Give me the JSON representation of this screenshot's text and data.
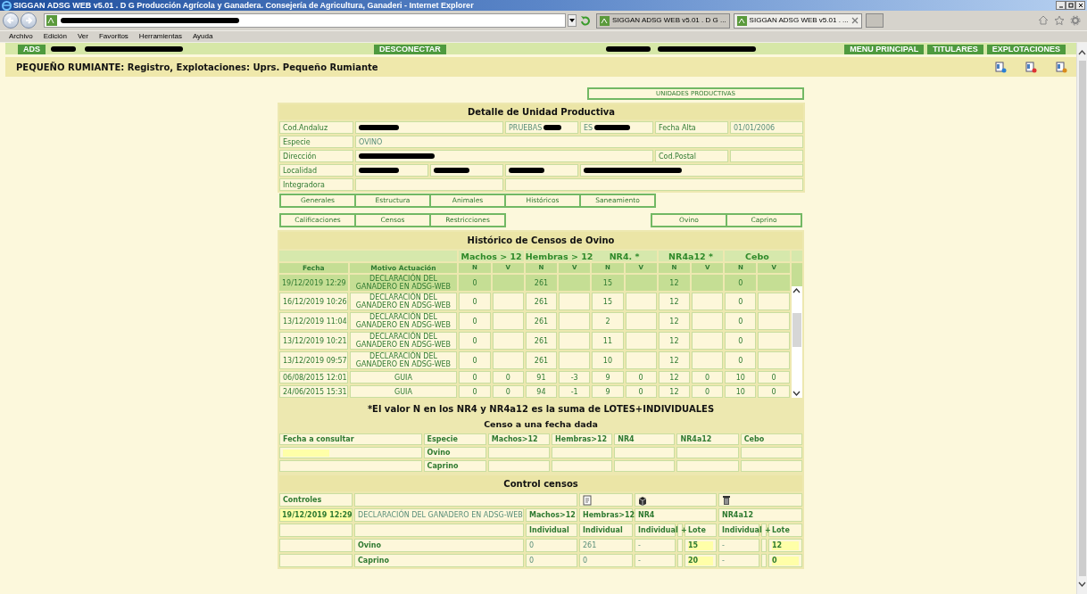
{
  "browser": {
    "title": "SIGGAN ADSG WEB v5.01 . D G Producción Agrícola y Ganadera. Consejería de Agricultura, Ganaderi - Internet Explorer",
    "address": {
      "redacted": true
    },
    "tabs": [
      {
        "label": "SIGGAN ADSG WEB v5.01 . D G ...",
        "selected": false
      },
      {
        "label": "SIGGAN ADSG WEB v5.01 . ...",
        "selected": true
      }
    ],
    "menu": [
      "Archivo",
      "Edición",
      "Ver",
      "Favoritos",
      "Herramientas",
      "Ayuda"
    ]
  },
  "nav": [
    {
      "label": "ADS"
    },
    {
      "redacted": true
    },
    {
      "redacted": true
    },
    {
      "label": "DESCONECTAR"
    },
    {
      "redacted": true
    },
    {
      "redacted": true
    },
    {
      "label": "MENU PRINCIPAL"
    },
    {
      "label": "TITULARES"
    },
    {
      "label": "EXPLOTACIONES"
    }
  ],
  "page_title": "PEQUEÑO RUMIANTE: Registro, Explotaciones: Uprs. Pequeño Rumiante",
  "unidades_button": "UNIDADES PRODUCTIVAS",
  "detail": {
    "title": "Detalle de Unidad Productiva",
    "rows": [
      {
        "label": "Cod.Andaluz",
        "cells": [
          {
            "redacted": true,
            "colspan": 2
          },
          {
            "text": "PRUEBAS",
            "redacted": true
          },
          {
            "text": "ES",
            "redacted": true
          },
          {
            "text": "Fecha Alta",
            "kind": "label"
          },
          {
            "text": "01/01/2006"
          }
        ]
      },
      {
        "label": "Especie",
        "cells": [
          {
            "text": "OVINO",
            "colspan": 6
          }
        ]
      },
      {
        "label": "Dirección",
        "cells": [
          {
            "redacted": true,
            "colspan": 4
          },
          {
            "text": "Cod.Postal",
            "kind": "label"
          },
          {}
        ]
      },
      {
        "label": "Localidad",
        "cells": [
          {
            "redacted": true
          },
          {
            "redacted": true
          },
          {
            "redacted": true
          },
          {
            "redacted": true,
            "colspan": 3
          }
        ]
      },
      {
        "label": "Integradora",
        "cells": [
          {
            "colspan": 2
          },
          {
            "colspan": 4
          }
        ]
      }
    ]
  },
  "tabs_main": [
    "Generales",
    "Estructura",
    "Animales",
    "Históricos",
    "Saneamiento"
  ],
  "tabs_second": [
    "Calificaciones",
    "Censos",
    "Restricciones"
  ],
  "species_tabs": [
    "Ovino",
    "Caprino"
  ],
  "historico": {
    "title": "Histórico de Censos de Ovino",
    "columns": [
      "Fecha",
      "Motivo Actuación"
    ],
    "groups": [
      {
        "label": "Machos > 12",
        "sub": [
          "N",
          "V"
        ]
      },
      {
        "label": "Hembras > 12",
        "sub": [
          "N",
          "V"
        ]
      },
      {
        "label": "NR4. *",
        "sub": [
          "N",
          "V"
        ]
      },
      {
        "label": "NR4a12 *",
        "sub": [
          "N",
          "V"
        ]
      },
      {
        "label": "Cebo",
        "sub": [
          "N",
          "V"
        ]
      }
    ],
    "rows": [
      {
        "fecha": "19/12/2019 12:29",
        "motivo": "DECLARACIÓN DEL GANADERO EN ADSG-WEB",
        "selected": true,
        "values": [
          {
            "n": "0"
          },
          {
            "n": "261"
          },
          {
            "n": "15"
          },
          {
            "n": "12"
          },
          {
            "n": "0"
          }
        ]
      },
      {
        "fecha": "16/12/2019 10:26",
        "motivo": "DECLARACIÓN DEL GANADERO EN ADSG-WEB",
        "selected": false,
        "values": [
          {
            "n": "0"
          },
          {
            "n": "261"
          },
          {
            "n": "15"
          },
          {
            "n": "12"
          },
          {
            "n": "0"
          }
        ]
      },
      {
        "fecha": "13/12/2019 11:04",
        "motivo": "DECLARACIÓN DEL GANADERO EN ADSG-WEB",
        "selected": false,
        "values": [
          {
            "n": "0"
          },
          {
            "n": "261"
          },
          {
            "n": "2"
          },
          {
            "n": "12"
          },
          {
            "n": "0"
          }
        ]
      },
      {
        "fecha": "13/12/2019 10:21",
        "motivo": "DECLARACIÓN DEL GANADERO EN ADSG-WEB",
        "selected": false,
        "values": [
          {
            "n": "0"
          },
          {
            "n": "261"
          },
          {
            "n": "11"
          },
          {
            "n": "12"
          },
          {
            "n": "0"
          }
        ]
      },
      {
        "fecha": "13/12/2019 09:57",
        "motivo": "DECLARACIÓN DEL GANADERO EN ADSG-WEB",
        "selected": false,
        "values": [
          {
            "n": "0"
          },
          {
            "n": "261"
          },
          {
            "n": "10"
          },
          {
            "n": "12"
          },
          {
            "n": "0"
          }
        ]
      },
      {
        "fecha": "06/08/2015 12:01",
        "motivo": "GUIA",
        "selected": false,
        "values": [
          {
            "n": "0",
            "v": "0"
          },
          {
            "n": "91",
            "v": "-3"
          },
          {
            "n": "9",
            "v": "0"
          },
          {
            "n": "12",
            "v": "0"
          },
          {
            "n": "10",
            "v": "0"
          }
        ]
      },
      {
        "fecha": "24/06/2015 15:31",
        "motivo": "GUIA",
        "selected": false,
        "values": [
          {
            "n": "0",
            "v": "0"
          },
          {
            "n": "94",
            "v": "-1"
          },
          {
            "n": "9",
            "v": "0"
          },
          {
            "n": "12",
            "v": "0"
          },
          {
            "n": "10",
            "v": "0"
          }
        ]
      }
    ]
  },
  "note": "*El valor N en los NR4 y NR4a12 es la suma de LOTES+INDIVIDUALES",
  "censo": {
    "title": "Censo a una fecha dada",
    "columns": [
      "Fecha a consultar",
      "Especie",
      "Machos>12",
      "Hembras>12",
      "NR4",
      "NR4a12",
      "Cebo"
    ],
    "species": [
      "Ovino",
      "Caprino"
    ]
  },
  "control": {
    "title": "Control censos",
    "header_label": "Controles",
    "date": "19/12/2019 12:29",
    "motivo": "DECLARACIÓN DEL GANADERO EN ADSG-WEB",
    "groups": [
      {
        "label": "Machos>12",
        "sub": [
          "Individual"
        ]
      },
      {
        "label": "Hembras>12",
        "sub": [
          "Individual"
        ]
      },
      {
        "label": "NR4",
        "sub": [
          "Individual",
          "+",
          "Lote"
        ]
      },
      {
        "label": "NR4a12",
        "sub": [
          "Individual",
          "+",
          "Lote"
        ]
      }
    ],
    "rows": [
      {
        "species": "Ovino",
        "machos": "0",
        "hembras": "261",
        "nr4_individual": "-",
        "nr4_lote": "15",
        "nr4a12_individual": "-",
        "nr4a12_lote": "12"
      },
      {
        "species": "Caprino",
        "machos": "0",
        "hembras": "0",
        "nr4_individual": "-",
        "nr4_lote": "20",
        "nr4a12_individual": "-",
        "nr4a12_lote": "0"
      }
    ]
  }
}
